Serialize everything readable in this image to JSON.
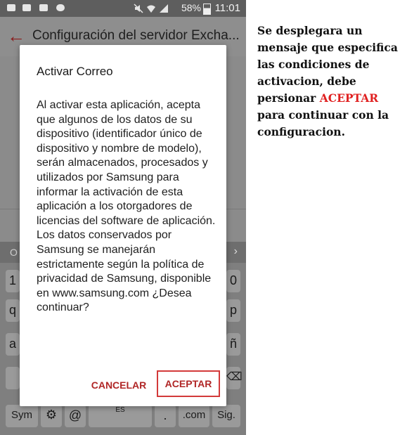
{
  "status_bar": {
    "battery": "58%",
    "time": "11:01",
    "icons": [
      "notification-icon",
      "image-icon",
      "mail-icon",
      "cloud-icon",
      "mute-icon",
      "wifi-icon",
      "signal-icon",
      "battery-icon"
    ]
  },
  "app_bar": {
    "title": "Configuración del servidor Excha..."
  },
  "dialog": {
    "title": "Activar Correo",
    "message": "Al activar esta aplicación, acepta que algunos de los datos de su dispositivo (identificador único de dispositivo y nombre de modelo), serán almacenados, procesados y utilizados por Samsung para informar la activación de esta aplicación a los otorgadores de licencias del software de aplicación. Los datos conservados por Samsung se manejarán estrictamente según la política de privacidad de Samsung, disponible en www.samsung.com ¿Desea continuar?",
    "cancel_label": "CANCELAR",
    "accept_label": "ACEPTAR"
  },
  "keyboard": {
    "top_partial": "O",
    "left_partial": [
      "1",
      "q",
      "a"
    ],
    "right_partial": [
      "0",
      "p",
      "ñ"
    ],
    "bottom": {
      "sym": "Sym",
      "at": "@",
      "lang": "ES",
      "dot": ".",
      "com": ".com",
      "sig": "Sig."
    }
  },
  "instruction": {
    "before": "Se desplegara un mensaje que especifica las condiciones de activacion, debe persionar ",
    "accent": "ACEPTAR",
    "after": " para continuar con la configuracion.",
    "accent_color": "#e02020"
  },
  "colors": {
    "button_text": "#b02626",
    "highlight_border": "#d33a3a"
  }
}
